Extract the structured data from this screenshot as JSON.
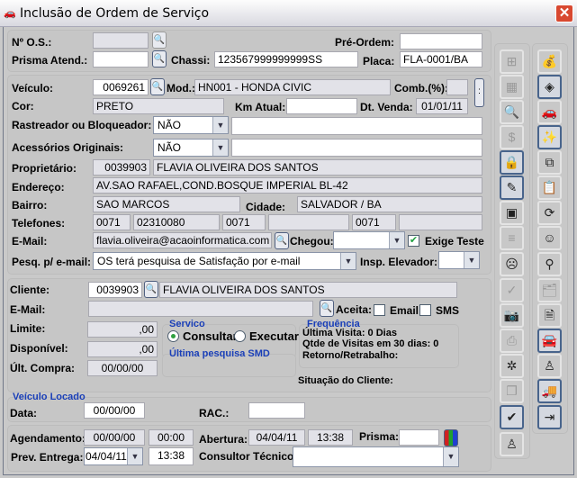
{
  "window": {
    "title": "Inclusão de Ordem de Serviço",
    "close_icon": "close-icon",
    "app_icon": "car-icon"
  },
  "header": {
    "os_label": "Nº O.S.:",
    "os_value": "",
    "pre_ordem_label": "Pré-Ordem:",
    "pre_ordem_value": "",
    "prisma_label": "Prisma Atend.:",
    "prisma_value": "",
    "chassi_label": "Chassi:",
    "chassi_value": "123567999999999SS",
    "placa_label": "Placa:",
    "placa_value": "FLA-0001/BA"
  },
  "vehicle": {
    "veiculo_label": "Veículo:",
    "veiculo_value": "0069261",
    "mod_label": "Mod.:",
    "mod_value": "HN001 - HONDA CIVIC",
    "comb_label": "Comb.(%):",
    "comb_value": "",
    "cor_label": "Cor:",
    "cor_value": "PRETO",
    "km_label": "Km Atual:",
    "km_value": "",
    "dt_venda_label": "Dt. Venda:",
    "dt_venda_value": "01/01/11",
    "rastreador_label": "Rastreador ou Bloqueador:",
    "rastreador_value": "NÃO",
    "rastreador_text": "",
    "acessorios_label": "Acessórios Originais:",
    "acessorios_value": "NÃO",
    "acessorios_text": "",
    "proprietario_label": "Proprietário:",
    "proprietario_code": "0039903",
    "proprietario_name": "FLAVIA OLIVEIRA DOS SANTOS",
    "endereco_label": "Endereço:",
    "endereco_value": "AV.SAO RAFAEL,COND.BOSQUE IMPERIAL BL-42",
    "bairro_label": "Bairro:",
    "bairro_value": "SAO MARCOS",
    "cidade_label": "Cidade:",
    "cidade_value": "SALVADOR / BA",
    "telefones_label": "Telefones:",
    "telefones": [
      "0071",
      "02310080",
      "0071",
      "",
      "0071",
      ""
    ],
    "email_label": "E-Mail:",
    "email_value": "flavia.oliveira@acaoinformatica.com",
    "chegou_label": "Chegou:",
    "chegou_value": "",
    "exige_teste_label": "Exige Teste",
    "exige_teste_checked": true,
    "pesq_label": "Pesq. p/ e-mail:",
    "pesq_value": "OS terá pesquisa de Satisfação por e-mail",
    "insp_label": "Insp. Elevador:",
    "insp_value": ""
  },
  "client": {
    "cliente_label": "Cliente:",
    "cliente_code": "0039903",
    "cliente_name": "FLAVIA OLIVEIRA DOS SANTOS",
    "email_label": "E-Mail:",
    "email_value": "",
    "aceita_label": "Aceita:",
    "aceita_email_label": "Email",
    "aceita_sms_label": "SMS",
    "aceita_email": false,
    "aceita_sms": false,
    "limite_label": "Limite:",
    "limite_value": ",00",
    "disponivel_label": "Disponível:",
    "disponivel_value": ",00",
    "ult_compra_label": "Últ. Compra:",
    "ult_compra_value": "00/00/00",
    "servico_label": "Servico",
    "consultar_label": "Consultar",
    "executar_label": "Executar",
    "servico_selected": "Consultar",
    "ultima_pesquisa_label": "Última pesquisa SMD",
    "frequencia_label": "Frequência",
    "ultima_visita": "Última Visita: 0 Dias",
    "qtde_visitas": "Qtde de Visitas em 30 dias: 0",
    "retorno": "Retorno/Retrabalho:",
    "situacao_label": "Situação do Cliente:"
  },
  "locado": {
    "title": "Veículo Locado",
    "data_label": "Data:",
    "data_value": "00/00/00",
    "rac_label": "RAC.:",
    "rac_value": ""
  },
  "schedule": {
    "agendamento_label": "Agendamento:",
    "agendamento_date": "00/00/00",
    "agendamento_time": "00:00",
    "abertura_label": "Abertura:",
    "abertura_date": "04/04/11",
    "abertura_time": "13:38",
    "prisma_label": "Prisma:",
    "prisma_value": "",
    "prev_label": "Prev. Entrega:",
    "prev_date": "04/04/11",
    "prev_time": "13:38",
    "consultor_label": "Consultor Técnico:",
    "consultor_value": ""
  },
  "toolbar": {
    "left": [
      {
        "icon": "flowchart-icon",
        "glyph": "⊞",
        "state": "disabled"
      },
      {
        "icon": "table-edit-icon",
        "glyph": "▦",
        "state": "disabled"
      },
      {
        "icon": "document-zoom-icon",
        "glyph": "🔍",
        "state": "disabled"
      },
      {
        "icon": "dollar-icon",
        "glyph": "$",
        "state": "disabled"
      },
      {
        "icon": "users-lock-icon",
        "glyph": "🔒",
        "state": "active"
      },
      {
        "icon": "edit-document-icon",
        "glyph": "✎",
        "state": "active"
      },
      {
        "icon": "toolbox-icon",
        "glyph": "▣",
        "state": "normal"
      },
      {
        "icon": "text-lines-icon",
        "glyph": "≡",
        "state": "disabled"
      },
      {
        "icon": "sad-face-icon",
        "glyph": "☹",
        "state": "normal"
      },
      {
        "icon": "check-icon",
        "glyph": "✓",
        "state": "disabled"
      },
      {
        "icon": "camera-icon",
        "glyph": "📷",
        "state": "normal"
      },
      {
        "icon": "printer-icon",
        "glyph": "⎙",
        "state": "disabled"
      },
      {
        "icon": "bug-icon",
        "glyph": "✲",
        "state": "normal"
      },
      {
        "icon": "copy-icon",
        "glyph": "❐",
        "state": "disabled"
      },
      {
        "icon": "save-check-icon",
        "glyph": "✔",
        "state": "active"
      },
      {
        "icon": "person-icon",
        "glyph": "♙",
        "state": "normal"
      }
    ],
    "right": [
      {
        "icon": "money-bag-icon",
        "glyph": "💰",
        "state": "normal"
      },
      {
        "icon": "coins-icon",
        "glyph": "◈",
        "state": "active"
      },
      {
        "icon": "car-icon",
        "glyph": "🚗",
        "state": "normal"
      },
      {
        "icon": "person-sparkle-icon",
        "glyph": "✨",
        "state": "active"
      },
      {
        "icon": "copy-question-icon",
        "glyph": "⧉",
        "state": "normal"
      },
      {
        "icon": "clipboard-icon",
        "glyph": "📋",
        "state": "normal"
      },
      {
        "icon": "refresh-icon",
        "glyph": "⟳",
        "state": "normal"
      },
      {
        "icon": "smiley-icon",
        "glyph": "☺",
        "state": "normal"
      },
      {
        "icon": "faucet-icon",
        "glyph": "⚲",
        "state": "normal"
      },
      {
        "icon": "folders-icon",
        "glyph": "🗂",
        "state": "disabled"
      },
      {
        "icon": "document-icon",
        "glyph": "🗎",
        "state": "normal"
      },
      {
        "icon": "car-front-icon",
        "glyph": "🚘",
        "state": "active"
      },
      {
        "icon": "person-icon",
        "glyph": "♙",
        "state": "normal"
      },
      {
        "icon": "truck-icon",
        "glyph": "🚚",
        "state": "active"
      },
      {
        "icon": "exit-door-icon",
        "glyph": "⇥",
        "state": "active"
      }
    ]
  }
}
